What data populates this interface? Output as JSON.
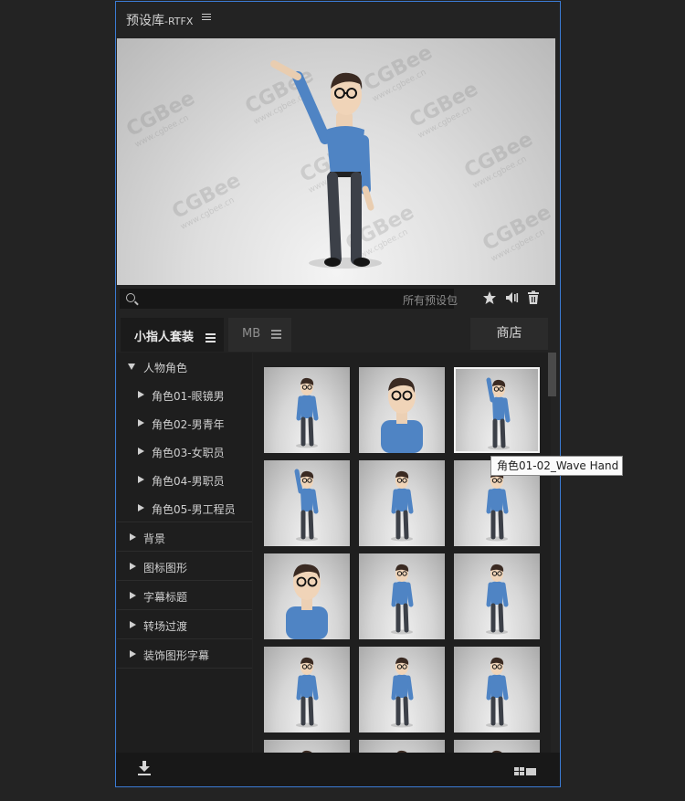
{
  "panel": {
    "title": "预设库",
    "title_suffix": "-RTFX",
    "menu_icon": "hamburger-icon"
  },
  "preview": {
    "watermark_text": "CGBee",
    "watermark_url": "www.cgbee.cn"
  },
  "search": {
    "value": "",
    "placeholder": "",
    "scope_label": "所有预设包",
    "icon": "search-icon"
  },
  "toolbar": {
    "favorite_icon": "star-icon",
    "audio_icon": "speaker-icon",
    "delete_icon": "trash-icon"
  },
  "tabs": [
    {
      "label": "小指人套装",
      "active": true
    },
    {
      "label": "MB",
      "active": false
    }
  ],
  "store_label": "商店",
  "tree": {
    "expanded_category": "人物角色",
    "children": [
      "角色01-眼镜男",
      "角色02-男青年",
      "角色03-女职员",
      "角色04-男职员",
      "角色05-男工程员"
    ],
    "categories": [
      "背景",
      "图标图形",
      "字幕标题",
      "转场过渡",
      "装饰图形字幕"
    ]
  },
  "tooltip": "角色01-02_Wave Hand",
  "footer": {
    "download_icon": "download-icon",
    "view_icon": "grid-view-icon"
  },
  "colors": {
    "panel_border": "#3b7bd4",
    "background": "#232323",
    "shirt": "#4f84c4"
  }
}
